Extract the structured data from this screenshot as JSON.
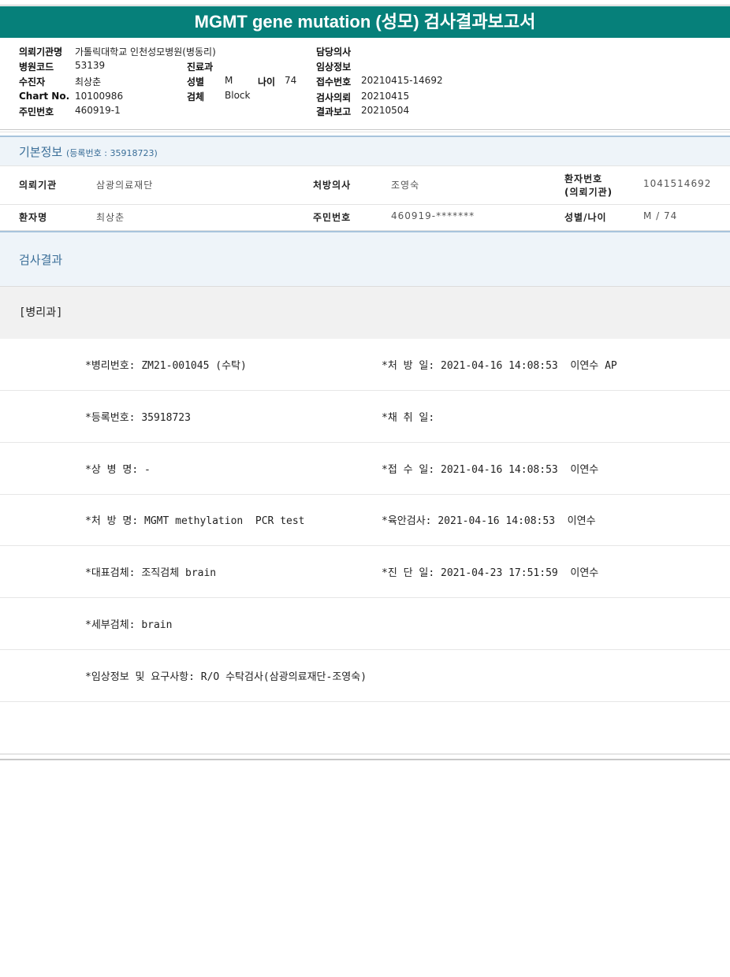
{
  "title": "MGMT gene mutation (성모) 검사결과보고서",
  "header": {
    "left": [
      {
        "label": "의뢰기관명",
        "value": "가톨릭대학교 인천성모병원(병동리)"
      },
      {
        "label": "병원코드",
        "value": "53139"
      },
      {
        "label": "수진자",
        "value": "최상춘"
      },
      {
        "label": "Chart No.",
        "value": "10100986"
      },
      {
        "label": "주민번호",
        "value": "460919-1"
      }
    ],
    "middle": [
      {
        "label": "진료과",
        "value": ""
      },
      {
        "label": "성별",
        "value": "M"
      },
      {
        "label": "검체",
        "value": "Block"
      }
    ],
    "age": {
      "label": "나이",
      "value": "74"
    },
    "right": [
      {
        "label": "담당의사",
        "value": ""
      },
      {
        "label": "임상정보",
        "value": ""
      },
      {
        "label": "접수번호",
        "value": "20210415-14692"
      },
      {
        "label": "검사의뢰",
        "value": "20210415"
      },
      {
        "label": "결과보고",
        "value": "20210504"
      }
    ]
  },
  "basic_info": {
    "title": "기본정보",
    "subtitle": "(등록번호 : 35918723)",
    "rows": [
      [
        {
          "label": "의뢰기관",
          "value": "삼광의료재단"
        },
        {
          "label": "처방의사",
          "value": "조영숙"
        },
        {
          "label": "환자번호",
          "label2": "(의뢰기관)",
          "value": "1041514692"
        }
      ],
      [
        {
          "label": "환자명",
          "value": "최상춘"
        },
        {
          "label": "주민번호",
          "value": "460919-*******"
        },
        {
          "label": "성별/나이",
          "value": "M / 74"
        }
      ]
    ]
  },
  "results": {
    "title": "검사결과",
    "department": "[병리과]",
    "rows": [
      {
        "left": "*병리번호: ZM21-001045 (수탁)",
        "right": "*처 방 일: 2021-04-16 14:08:53  이연수 AP"
      },
      {
        "left": "*등록번호: 35918723",
        "right": "*채 취 일:"
      },
      {
        "left": "*상 병 명: -",
        "right": "*접 수 일: 2021-04-16 14:08:53  이연수"
      },
      {
        "left": "*처 방 명: MGMT methylation  PCR test",
        "right": "*육안검사: 2021-04-16 14:08:53  이연수"
      },
      {
        "left": "*대표검체: 조직검체 brain",
        "right": "*진 단 일: 2021-04-23 17:51:59  이연수"
      },
      {
        "left": "*세부검체: brain",
        "right": ""
      },
      {
        "left": "*임상정보 및 요구사항: R/O 수탁검사(삼광의료재단-조영숙)",
        "right": ""
      },
      {
        "left": "",
        "right": ""
      }
    ]
  }
}
